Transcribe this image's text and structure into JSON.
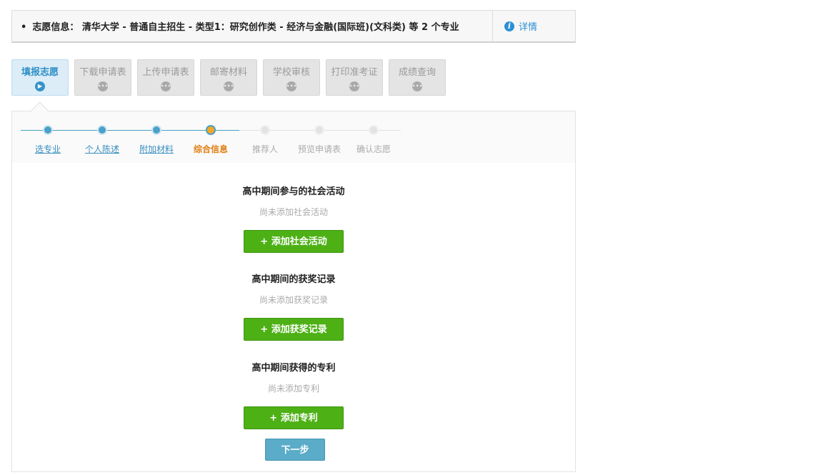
{
  "info_bar": {
    "text": "志愿信息： 清华大学 - 普通自主招生 - 类型1：研究创作类 - 经济与金融(国际班)(文科类) 等 2 个专业",
    "detail_label": "详情"
  },
  "step_tabs": [
    {
      "label": "填报志愿",
      "active": true
    },
    {
      "label": "下载申请表",
      "active": false
    },
    {
      "label": "上传申请表",
      "active": false
    },
    {
      "label": "邮寄材料",
      "active": false
    },
    {
      "label": "学校审核",
      "active": false
    },
    {
      "label": "打印准考证",
      "active": false
    },
    {
      "label": "成绩查询",
      "active": false
    }
  ],
  "progress": [
    {
      "label": "选专业",
      "state": "done"
    },
    {
      "label": "个人陈述",
      "state": "done"
    },
    {
      "label": "附加材料",
      "state": "done"
    },
    {
      "label": "综合信息",
      "state": "current"
    },
    {
      "label": "推荐人",
      "state": "todo"
    },
    {
      "label": "预览申请表",
      "state": "todo"
    },
    {
      "label": "确认志愿",
      "state": "todo"
    }
  ],
  "sections": [
    {
      "title": "高中期间参与的社会活动",
      "empty": "尚未添加社会活动",
      "button": "+ 添加社会活动"
    },
    {
      "title": "高中期间的获奖记录",
      "empty": "尚未添加获奖记录",
      "button": "+ 添加获奖记录"
    },
    {
      "title": "高中期间获得的专利",
      "empty": "尚未添加专利",
      "button": "+ 添加专利"
    }
  ],
  "next_button": "下一步",
  "colors": {
    "accent_blue": "#3593c8",
    "progress_done": "#4aa0c8",
    "progress_current": "#f5a623",
    "add_green": "#4db015",
    "next_blue": "#5aacc8"
  }
}
